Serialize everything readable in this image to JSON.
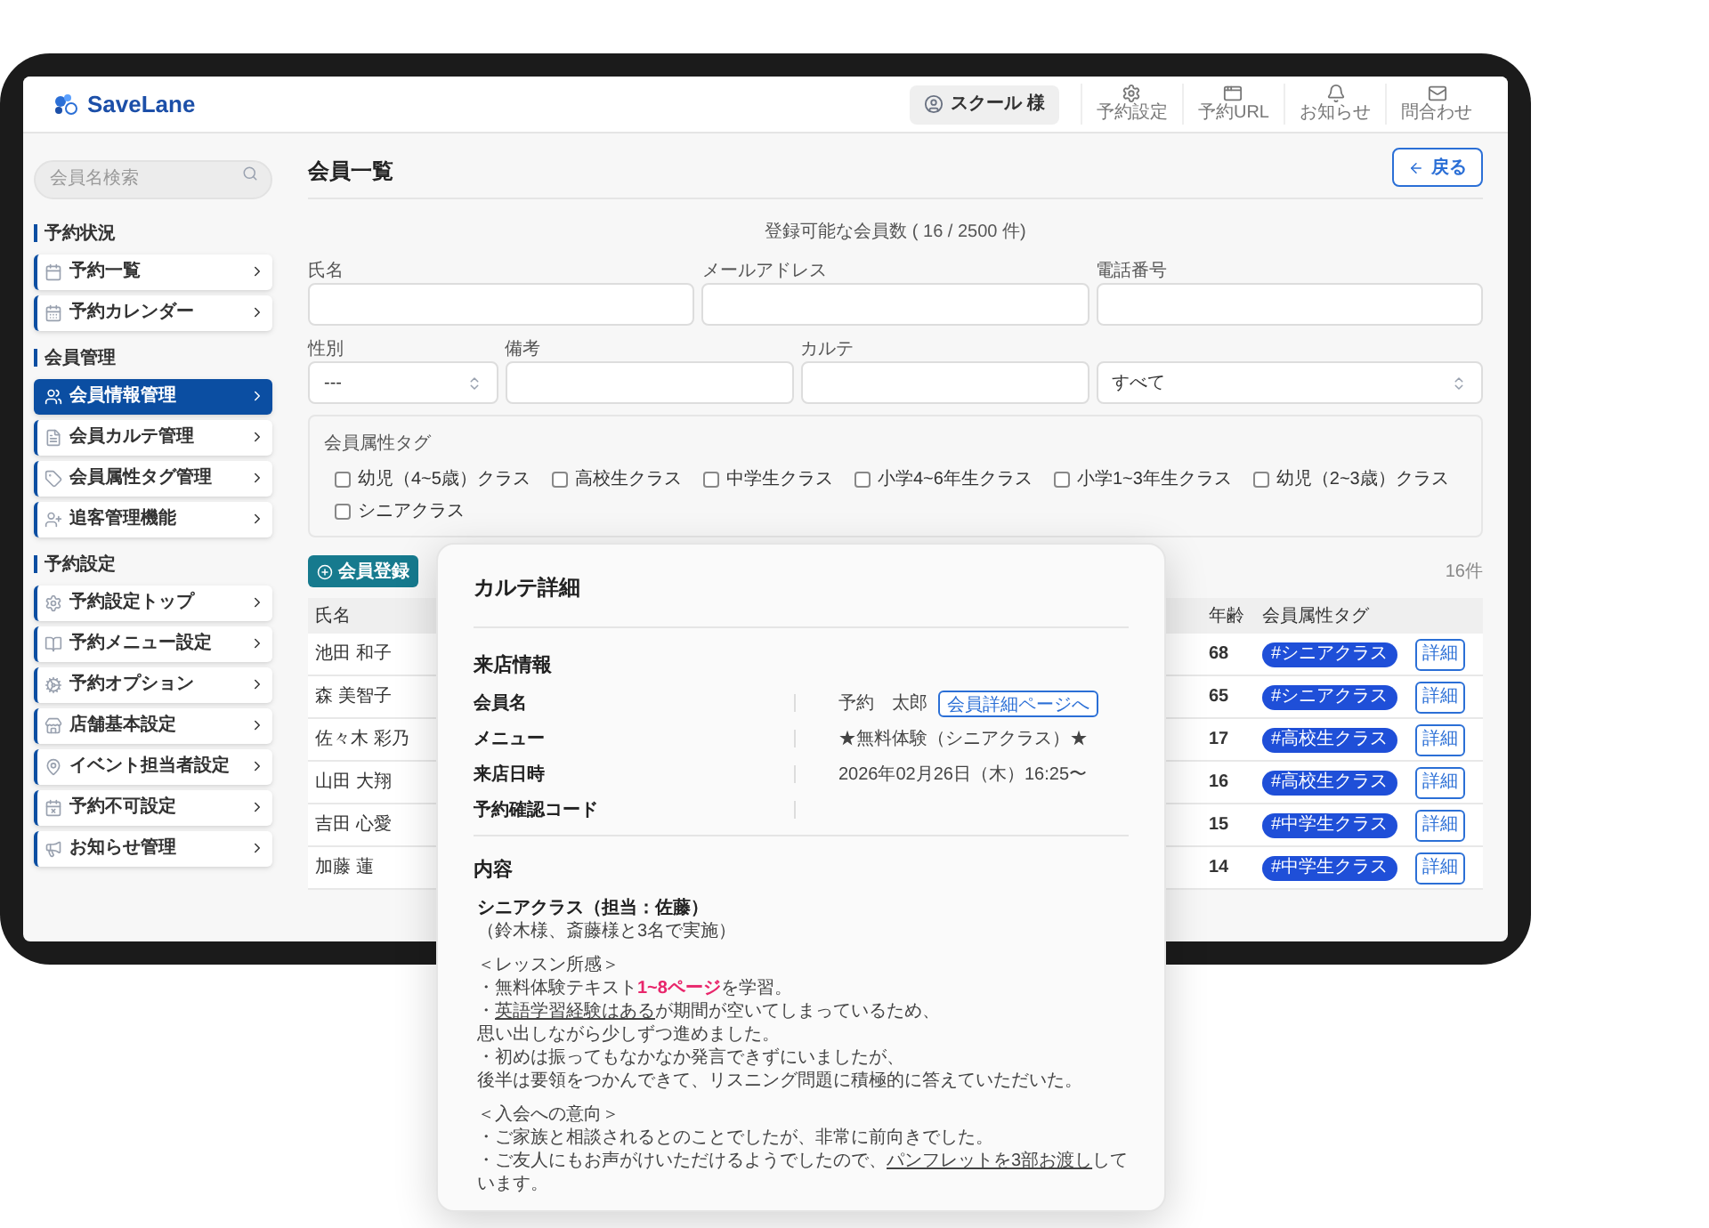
{
  "header": {
    "logo": "SaveLane",
    "user": "スクール 様",
    "actions": [
      {
        "label": "予約設定"
      },
      {
        "label": "予約URL"
      },
      {
        "label": "お知らせ"
      },
      {
        "label": "問合わせ"
      }
    ]
  },
  "sidebar": {
    "search": {
      "placeholder": "会員名検索"
    },
    "sections": [
      {
        "title": "予約状況",
        "items": [
          {
            "label": "予約一覧",
            "selected": false
          },
          {
            "label": "予約カレンダー",
            "selected": false
          }
        ]
      },
      {
        "title": "会員管理",
        "items": [
          {
            "label": "会員情報管理",
            "selected": true
          },
          {
            "label": "会員カルテ管理",
            "selected": false
          },
          {
            "label": "会員属性タグ管理",
            "selected": false
          },
          {
            "label": "追客管理機能",
            "selected": false
          }
        ]
      },
      {
        "title": "予約設定",
        "items": [
          {
            "label": "予約設定トップ",
            "selected": false
          },
          {
            "label": "予約メニュー設定",
            "selected": false
          },
          {
            "label": "予約オプション",
            "selected": false
          },
          {
            "label": "店舗基本設定",
            "selected": false
          },
          {
            "label": "イベント担当者設定",
            "selected": false
          },
          {
            "label": "予約不可設定",
            "selected": false
          },
          {
            "label": "お知らせ管理",
            "selected": false
          }
        ]
      }
    ]
  },
  "page": {
    "title": "会員一覧",
    "back_button": "戻る",
    "count_note": "登録可能な会員数 ( 16 / 2500 件)"
  },
  "filter_fields": [
    {
      "label": "氏名",
      "kind": "text"
    },
    {
      "label": "メールアドレス",
      "kind": "text"
    },
    {
      "label": "電話番号",
      "kind": "text"
    },
    {
      "label": "性別",
      "kind": "select",
      "value": "---"
    },
    {
      "label": "備考",
      "kind": "text"
    },
    {
      "label": "カルテ",
      "kind": "text"
    },
    {
      "kind": "select",
      "value": "すべて"
    }
  ],
  "tag_filter": {
    "legend": "会員属性タグ",
    "options": [
      {
        "label": "幼児（4~5歳）クラス",
        "checked": false
      },
      {
        "label": "高校生クラス",
        "checked": false
      },
      {
        "label": "中学生クラス",
        "checked": false
      },
      {
        "label": "小学4~6年生クラス",
        "checked": false
      },
      {
        "label": "小学1~3年生クラス",
        "checked": false
      },
      {
        "label": "幼児（2~3歳）クラス",
        "checked": false
      },
      {
        "label": "シニアクラス",
        "checked": false
      }
    ]
  },
  "toolbar": {
    "register_button": "会員登録",
    "count": "16件"
  },
  "table": {
    "columns": [
      "氏名",
      "年齢",
      "会員属性タグ"
    ],
    "rows": [
      {
        "name": "池田 和子",
        "age": "68",
        "tag": "#シニアクラス",
        "action": "詳細"
      },
      {
        "name": "森 美智子",
        "age": "65",
        "tag": "#シニアクラス",
        "action": "詳細"
      },
      {
        "name": "佐々木 彩乃",
        "age": "17",
        "tag": "#高校生クラス",
        "action": "詳細"
      },
      {
        "name": "山田 大翔",
        "age": "16",
        "tag": "#高校生クラス",
        "action": "詳細"
      },
      {
        "name": "吉田 心愛",
        "age": "15",
        "tag": "#中学生クラス",
        "action": "詳細"
      },
      {
        "name": "加藤 蓮",
        "age": "14",
        "tag": "#中学生クラス",
        "action": "詳細"
      }
    ]
  },
  "modal": {
    "title": "カルテ詳細",
    "visit_heading": "来店情報",
    "fields": [
      {
        "label": "会員名",
        "value": "予約　太郎",
        "link": "会員詳細ページへ"
      },
      {
        "label": "メニュー",
        "value": "★無料体験（シニアクラス）★"
      },
      {
        "label": "来店日時",
        "value": "2026年02月26日（木）16:25〜"
      },
      {
        "label": "予約確認コード"
      }
    ],
    "content_heading": "内容",
    "paragraphs": [
      [
        {
          "kind": "heading",
          "segments": [
            {
              "text": "シニアクラス（担当：佐藤）",
              "kind": "plain"
            }
          ]
        },
        {
          "kind": "body",
          "segments": [
            {
              "text": "（鈴木様、斎藤様と3名で実施）",
              "kind": "plain"
            }
          ]
        }
      ],
      [
        {
          "kind": "body",
          "segments": [
            {
              "text": "＜レッスン所感＞",
              "kind": "plain"
            }
          ]
        },
        {
          "kind": "body",
          "segments": [
            {
              "text": "・無料体験テキスト",
              "kind": "plain"
            },
            {
              "text": "1~8ページ",
              "kind": "red"
            },
            {
              "text": "を学習。",
              "kind": "plain"
            }
          ]
        },
        {
          "kind": "body",
          "segments": [
            {
              "text": "・",
              "kind": "plain"
            },
            {
              "text": "英語学習経験はある",
              "kind": "underline"
            },
            {
              "text": "が期間が空いてしまっているため、",
              "kind": "plain"
            }
          ]
        },
        {
          "kind": "body",
          "segments": [
            {
              "text": "思い出しながら少しずつ進めました。",
              "kind": "plain"
            }
          ]
        },
        {
          "kind": "body",
          "segments": [
            {
              "text": "・初めは振ってもなかなか発言できずにいましたが、",
              "kind": "plain"
            }
          ]
        },
        {
          "kind": "body",
          "segments": [
            {
              "text": "後半は要領をつかんできて、リスニング問題に積極的に答えていただいた。",
              "kind": "plain"
            }
          ]
        }
      ],
      [
        {
          "kind": "body",
          "segments": [
            {
              "text": "＜入会への意向＞",
              "kind": "plain"
            }
          ]
        },
        {
          "kind": "body",
          "segments": [
            {
              "text": "・ご家族と相談されるとのことでしたが、非常に前向きでした。",
              "kind": "plain"
            }
          ]
        },
        {
          "kind": "body",
          "segments": [
            {
              "text": "・ご友人にもお声がけいただけるようでしたので、",
              "kind": "plain"
            },
            {
              "text": "パンフレットを3部お渡し",
              "kind": "underline"
            },
            {
              "text": "しています。",
              "kind": "plain"
            }
          ]
        }
      ]
    ]
  }
}
